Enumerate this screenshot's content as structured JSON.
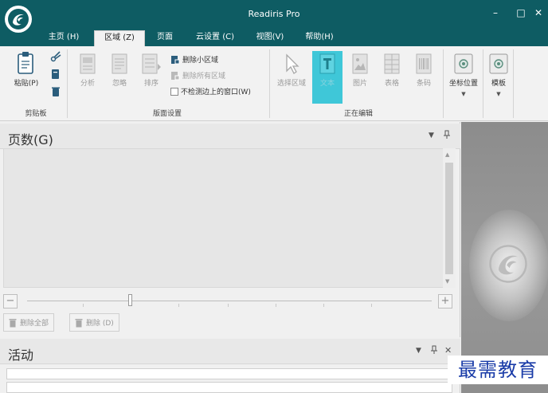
{
  "window": {
    "title": "Readiris Pro",
    "controls": {
      "minimize": "–",
      "maximize": "□",
      "close": "✕"
    }
  },
  "tabs": [
    {
      "label": "主页 (H)",
      "active": false
    },
    {
      "label": "区域 (Z)",
      "active": true
    },
    {
      "label": "页面",
      "active": false
    },
    {
      "label": "云设置 (C)",
      "active": false
    },
    {
      "label": "视图(V)",
      "active": false
    },
    {
      "label": "帮助(H)",
      "active": false
    }
  ],
  "ribbon": {
    "clipboard": {
      "paste_label": "粘贴(P)",
      "group_label": "剪贴板",
      "small_icons": [
        "cut-icon",
        "copy-icon",
        "delete-icon"
      ]
    },
    "layout": {
      "group_label": "版面设置",
      "analyze_label": "分析",
      "ignore_label": "忽略",
      "sort_label": "排序",
      "remove_small_zones": "删除小区域",
      "remove_all_zones": "删除所有区域",
      "dont_detect_label": "不检测边上的窗口(W)",
      "dont_detect_checked": false
    },
    "editing": {
      "group_label": "正在编辑",
      "select_zone_label": "选择区域",
      "text_label": "文本",
      "picture_label": "图片",
      "table_label": "表格",
      "barcode_label": "条码",
      "selected_tool": "text"
    },
    "coord_label": "坐标位置",
    "template_label": "模板"
  },
  "pages_panel": {
    "title": "页数(G)",
    "pin_icon": "pin-icon",
    "zoom_minus": "−",
    "zoom_plus": "+",
    "zoom_level": 0.25,
    "delete_all_label": "删除全部",
    "delete_label": "删除 (D)"
  },
  "activity_panel": {
    "title": "活动",
    "close": "✕"
  },
  "watermark": "最需教育",
  "colors": {
    "title_bar": "#0e5c63",
    "selected_tool": "#3fc7d8",
    "watermark_text": "#1a3ca8"
  }
}
